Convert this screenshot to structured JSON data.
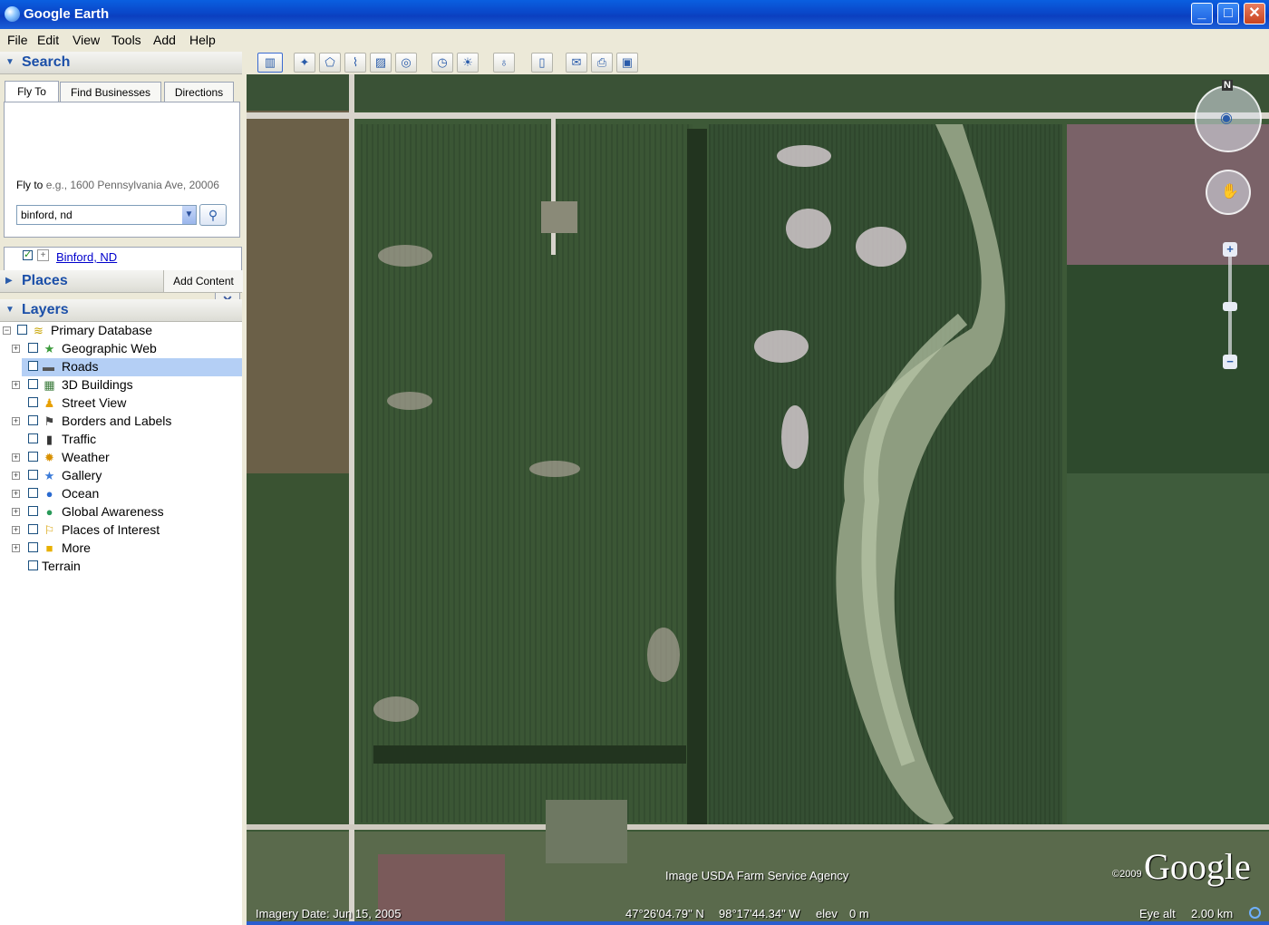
{
  "window": {
    "title": "Google Earth"
  },
  "menu": [
    "File",
    "Edit",
    "View",
    "Tools",
    "Add",
    "Help"
  ],
  "search": {
    "header": "Search",
    "tabs": [
      "Fly To",
      "Find Businesses",
      "Directions"
    ],
    "fly_to_label": "Fly to",
    "fly_to_hint": "e.g., 1600 Pennsylvania Ave, 20006",
    "input_value": "binford, nd",
    "result": "Binford, ND"
  },
  "places": {
    "header": "Places",
    "add_content": "Add Content"
  },
  "layers": {
    "header": "Layers",
    "items": [
      {
        "label": "Primary Database",
        "icon": "database-icon"
      },
      {
        "label": "Geographic Web",
        "icon": "star-icon"
      },
      {
        "label": "Roads",
        "icon": "road-icon"
      },
      {
        "label": "3D Buildings",
        "icon": "building-icon"
      },
      {
        "label": "Street View",
        "icon": "pegman-icon"
      },
      {
        "label": "Borders and Labels",
        "icon": "flag-icon"
      },
      {
        "label": "Traffic",
        "icon": "traffic-light-icon"
      },
      {
        "label": "Weather",
        "icon": "sun-icon"
      },
      {
        "label": "Gallery",
        "icon": "star-icon"
      },
      {
        "label": "Ocean",
        "icon": "globe-icon"
      },
      {
        "label": "Global Awareness",
        "icon": "globe-icon"
      },
      {
        "label": "Places of Interest",
        "icon": "pin-icon"
      },
      {
        "label": "More",
        "icon": "square-icon"
      },
      {
        "label": "Terrain",
        "icon": "none"
      }
    ],
    "selected": "Roads"
  },
  "map": {
    "attribution": "Image USDA Farm Service Agency",
    "copyright": "©2009",
    "brand": "Google",
    "imagery_date": "Imagery Date: Jun 15, 2005",
    "lat": "47°26'04.79\" N",
    "lon": "98°17'44.34\" W",
    "elev_label": "elev",
    "elev_value": "0 m",
    "eye_alt_label": "Eye alt",
    "eye_alt_value": "2.00 km",
    "compass_north": "N"
  }
}
